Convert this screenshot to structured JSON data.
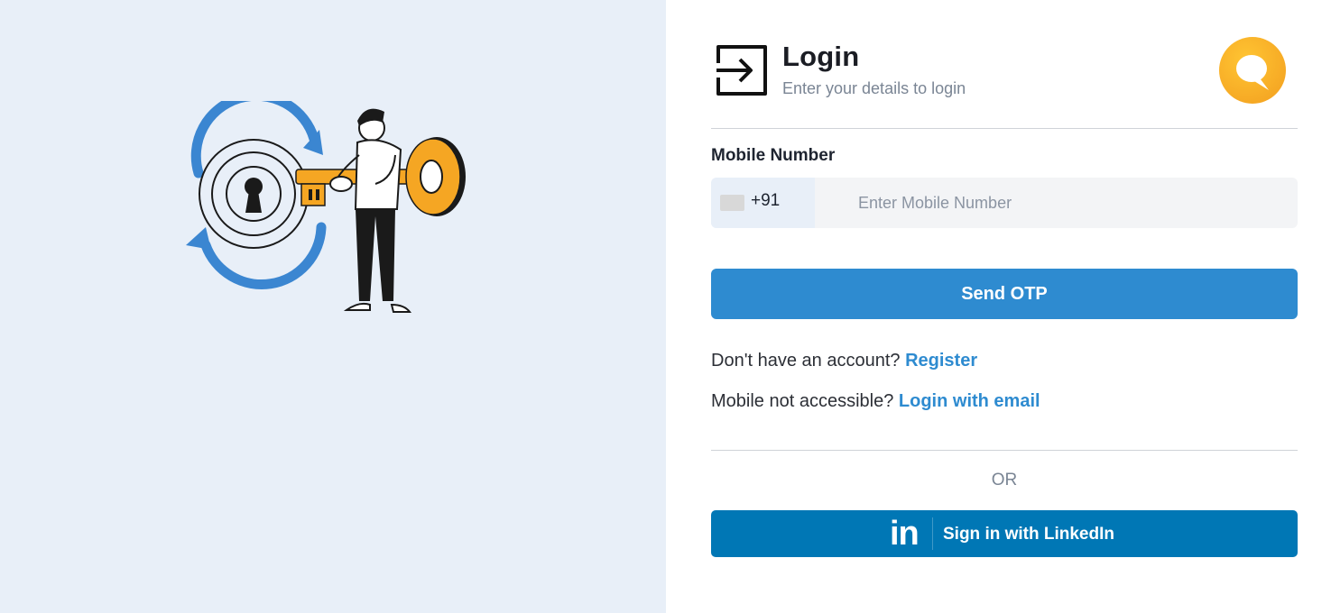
{
  "illustration": {
    "icon": "person-with-key-illustration"
  },
  "header": {
    "icon": "login-arrow-icon",
    "title": "Login",
    "subtitle": "Enter your details to login",
    "brand_logo": "chat-bubble-logo-icon"
  },
  "form": {
    "mobile_label": "Mobile Number",
    "country_code": "+91",
    "mobile_placeholder": "Enter Mobile Number",
    "mobile_value": "",
    "send_otp_label": "Send OTP"
  },
  "register": {
    "prompt": "Don't have an account?",
    "link": "Register"
  },
  "email_login": {
    "prompt": "Mobile not accessible?",
    "link": "Login with email"
  },
  "or_text": "OR",
  "linkedin": {
    "icon_text": "in",
    "label": "Sign in with LinkedIn"
  },
  "colors": {
    "left_bg": "#e8eff8",
    "primary": "#2e8bd0",
    "linkedin": "#0077b5",
    "accent_key": "#f5a623"
  }
}
